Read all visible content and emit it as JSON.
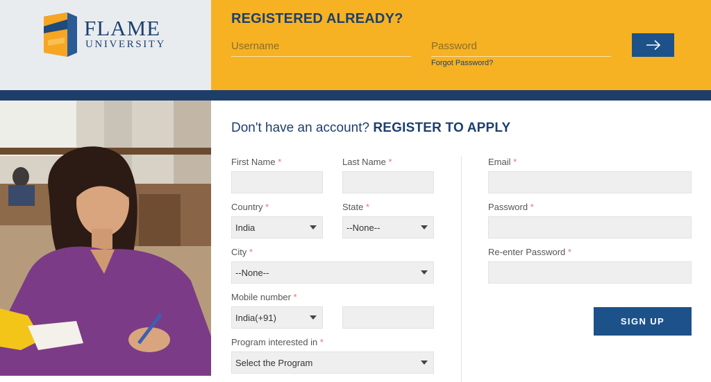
{
  "brand": {
    "line1": "FLAME",
    "line2": "UNIVERSITY"
  },
  "login": {
    "title": "REGISTERED ALREADY?",
    "username_placeholder": "Username",
    "password_placeholder": "Password",
    "forgot_label": "Forgot Password?",
    "submit_icon": "arrow-right-icon"
  },
  "register": {
    "heading_prefix": "Don't have an account?",
    "heading_strong": "REGISTER TO APPLY",
    "required_marker": "*",
    "fields": {
      "first_name": {
        "label": "First Name",
        "value": ""
      },
      "last_name": {
        "label": "Last Name",
        "value": ""
      },
      "country": {
        "label": "Country",
        "value": "India"
      },
      "state": {
        "label": "State",
        "value": "--None--"
      },
      "city": {
        "label": "City",
        "value": "--None--"
      },
      "mobile": {
        "label": "Mobile number",
        "code_value": "India(+91)",
        "number_value": ""
      },
      "program": {
        "label": "Program interested in",
        "value": "Select the Program"
      },
      "email": {
        "label": "Email",
        "value": ""
      },
      "password": {
        "label": "Password",
        "value": ""
      },
      "reenter_password": {
        "label": "Re-enter Password",
        "value": ""
      }
    },
    "signup_label": "SIGN UP"
  },
  "colors": {
    "accent": "#f6b222",
    "navy": "#1d3e69",
    "button": "#1c5289",
    "required": "#e57373"
  }
}
